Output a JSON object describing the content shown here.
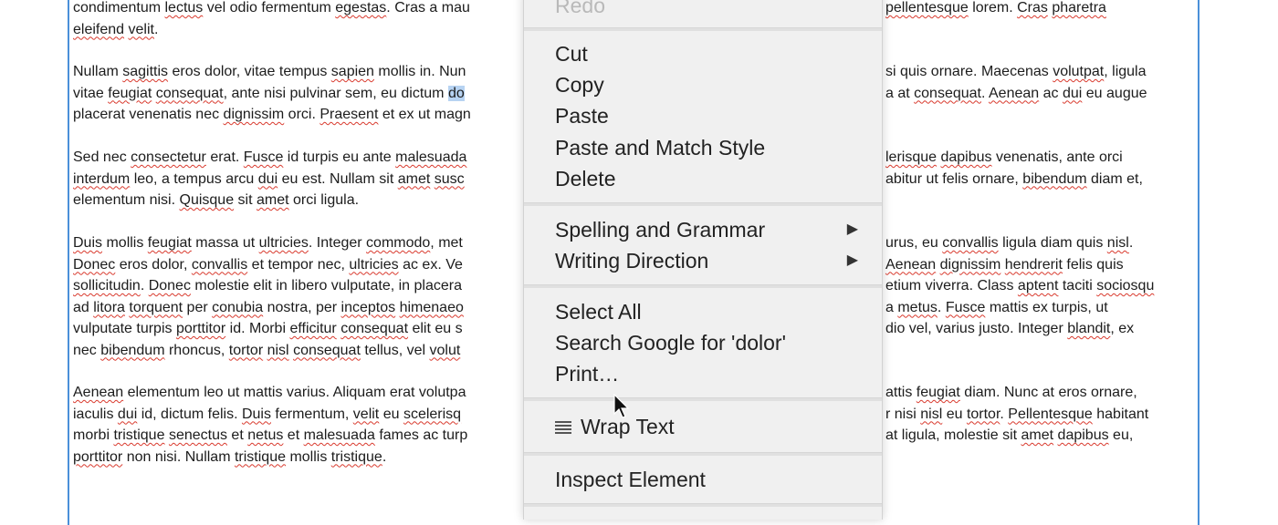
{
  "document": {
    "paragraphs": [
      {
        "lines": [
          [
            {
              "t": "condimentum "
            },
            {
              "t": "lectus",
              "sp": true
            },
            {
              "t": " vel odio fermentum "
            },
            {
              "t": "egestas",
              "sp": true
            },
            {
              "t": ". Cras a mau"
            }
          ],
          [
            {
              "t": "eleifend",
              "sp": true
            },
            {
              "t": " "
            },
            {
              "t": "velit",
              "sp": true
            },
            {
              "t": "."
            }
          ]
        ],
        "right_lines": [
          [
            {
              "t": "pellentesque",
              "sp": true
            },
            {
              "t": " lorem. "
            },
            {
              "t": "Cras",
              "sp": true
            },
            {
              "t": " "
            },
            {
              "t": "pharetra",
              "sp": true
            }
          ]
        ]
      },
      {
        "lines": [
          [
            {
              "t": "Nullam "
            },
            {
              "t": "sagittis",
              "sp": true
            },
            {
              "t": " eros dolor, vitae tempus "
            },
            {
              "t": "sapien",
              "sp": true
            },
            {
              "t": " mollis in. Nun"
            }
          ],
          [
            {
              "t": "vitae "
            },
            {
              "t": "feugiat",
              "sp": true
            },
            {
              "t": " "
            },
            {
              "t": "consequat",
              "sp": true
            },
            {
              "t": ", ante nisi pulvinar sem, eu dictum "
            },
            {
              "t": "do",
              "hl": true
            }
          ],
          [
            {
              "t": "placerat venenatis nec "
            },
            {
              "t": "dignissim",
              "sp": true
            },
            {
              "t": " orci. "
            },
            {
              "t": "Praesent",
              "sp": true
            },
            {
              "t": " et ex ut magn"
            }
          ]
        ],
        "right_lines": [
          [
            {
              "t": "si quis ornare. Maecenas "
            },
            {
              "t": "volutpat",
              "sp": true
            },
            {
              "t": ", ligula"
            }
          ],
          [
            {
              "t": "a at "
            },
            {
              "t": "consequat",
              "sp": true
            },
            {
              "t": ". "
            },
            {
              "t": "Aenean",
              "sp": true
            },
            {
              "t": " ac "
            },
            {
              "t": "dui",
              "sp": true
            },
            {
              "t": " eu augue"
            }
          ]
        ]
      },
      {
        "lines": [
          [
            {
              "t": "Sed nec "
            },
            {
              "t": "consectetur",
              "sp": true
            },
            {
              "t": " erat. "
            },
            {
              "t": "Fusce",
              "sp": true
            },
            {
              "t": " id turpis eu ante "
            },
            {
              "t": "malesuada",
              "sp": true
            }
          ],
          [
            {
              "t": "interdum",
              "sp": true
            },
            {
              "t": " leo, a tempus arcu "
            },
            {
              "t": "dui",
              "sp": true
            },
            {
              "t": " eu est. Nullam sit "
            },
            {
              "t": "amet",
              "sp": true
            },
            {
              "t": " "
            },
            {
              "t": "susc",
              "sp": true
            }
          ],
          [
            {
              "t": "elementum nisi. "
            },
            {
              "t": "Quisque",
              "sp": true
            },
            {
              "t": " sit "
            },
            {
              "t": "amet",
              "sp": true
            },
            {
              "t": " orci ligula."
            }
          ]
        ],
        "right_lines": [
          [
            {
              "t": "lerisque",
              "sp": true
            },
            {
              "t": " "
            },
            {
              "t": "dapibus",
              "sp": true
            },
            {
              "t": " venenatis, ante orci"
            }
          ],
          [
            {
              "t": "abitur ut felis ornare, "
            },
            {
              "t": "bibendum",
              "sp": true
            },
            {
              "t": " diam et,"
            }
          ]
        ]
      },
      {
        "lines": [
          [
            {
              "t": "Duis",
              "sp": true
            },
            {
              "t": " mollis "
            },
            {
              "t": "feugiat",
              "sp": true
            },
            {
              "t": " massa ut "
            },
            {
              "t": "ultricies",
              "sp": true
            },
            {
              "t": ". Integer "
            },
            {
              "t": "commodo",
              "sp": true
            },
            {
              "t": ", met"
            }
          ],
          [
            {
              "t": "Donec",
              "sp": true
            },
            {
              "t": " eros dolor, "
            },
            {
              "t": "convallis",
              "sp": true
            },
            {
              "t": " et tempor nec, "
            },
            {
              "t": "ultricies",
              "sp": true
            },
            {
              "t": " ac ex. Ve"
            }
          ],
          [
            {
              "t": "sollicitudin",
              "sp": true
            },
            {
              "t": ". "
            },
            {
              "t": "Donec",
              "sp": true
            },
            {
              "t": " molestie elit in libero vulputate, in placera"
            }
          ],
          [
            {
              "t": "ad "
            },
            {
              "t": "litora",
              "sp": true
            },
            {
              "t": " "
            },
            {
              "t": "torquent",
              "sp": true
            },
            {
              "t": " per "
            },
            {
              "t": "conubia",
              "sp": true
            },
            {
              "t": " nostra, per "
            },
            {
              "t": "inceptos",
              "sp": true
            },
            {
              "t": " "
            },
            {
              "t": "himenaeo",
              "sp": true
            }
          ],
          [
            {
              "t": "vulputate turpis "
            },
            {
              "t": "porttitor",
              "sp": true
            },
            {
              "t": " id. Morbi "
            },
            {
              "t": "efficitur",
              "sp": true
            },
            {
              "t": " "
            },
            {
              "t": "consequat",
              "sp": true
            },
            {
              "t": " elit eu s"
            }
          ],
          [
            {
              "t": "nec "
            },
            {
              "t": "bibendum",
              "sp": true
            },
            {
              "t": " rhoncus, "
            },
            {
              "t": "tortor",
              "sp": true
            },
            {
              "t": " "
            },
            {
              "t": "nisl",
              "sp": true
            },
            {
              "t": " "
            },
            {
              "t": "consequat",
              "sp": true
            },
            {
              "t": " tellus, vel "
            },
            {
              "t": "volut",
              "sp": true
            }
          ]
        ],
        "right_lines": [
          [
            {
              "t": "urus, eu "
            },
            {
              "t": "convallis",
              "sp": true
            },
            {
              "t": " ligula diam quis "
            },
            {
              "t": "nisl",
              "sp": true
            },
            {
              "t": "."
            }
          ],
          [
            {
              "t": "Aenean",
              "sp": true
            },
            {
              "t": " "
            },
            {
              "t": "dignissim",
              "sp": true
            },
            {
              "t": " "
            },
            {
              "t": "hendrerit",
              "sp": true
            },
            {
              "t": " felis quis"
            }
          ],
          [
            {
              "t": "etium viverra. Class "
            },
            {
              "t": "aptent",
              "sp": true
            },
            {
              "t": " taciti "
            },
            {
              "t": "sociosqu",
              "sp": true
            }
          ],
          [
            {
              "t": "a "
            },
            {
              "t": "metus",
              "sp": true
            },
            {
              "t": ". "
            },
            {
              "t": "Fusce",
              "sp": true
            },
            {
              "t": " mattis ex turpis, ut"
            }
          ],
          [
            {
              "t": "dio vel, varius justo. Integer "
            },
            {
              "t": "blandit",
              "sp": true
            },
            {
              "t": ", ex"
            }
          ]
        ]
      },
      {
        "lines": [
          [
            {
              "t": "Aenean",
              "sp": true
            },
            {
              "t": " elementum leo ut mattis varius. Aliquam erat volutpa"
            }
          ],
          [
            {
              "t": "iaculis "
            },
            {
              "t": "dui",
              "sp": true
            },
            {
              "t": " id, dictum felis. "
            },
            {
              "t": "Duis",
              "sp": true
            },
            {
              "t": " fermentum, "
            },
            {
              "t": "velit",
              "sp": true
            },
            {
              "t": " eu "
            },
            {
              "t": "scelerisq",
              "sp": true
            }
          ],
          [
            {
              "t": "morbi "
            },
            {
              "t": "tristique",
              "sp": true
            },
            {
              "t": " "
            },
            {
              "t": "senectus",
              "sp": true
            },
            {
              "t": " et "
            },
            {
              "t": "netus",
              "sp": true
            },
            {
              "t": " et "
            },
            {
              "t": "malesuada",
              "sp": true
            },
            {
              "t": " fames ac turp"
            }
          ],
          [
            {
              "t": "porttitor",
              "sp": true
            },
            {
              "t": " non nisi. Nullam "
            },
            {
              "t": "tristique",
              "sp": true
            },
            {
              "t": " mollis "
            },
            {
              "t": "tristique",
              "sp": true
            },
            {
              "t": "."
            }
          ]
        ],
        "right_lines": [
          [
            {
              "t": "attis "
            },
            {
              "t": "feugiat",
              "sp": true
            },
            {
              "t": " diam. Nunc at eros ornare,"
            }
          ],
          [
            {
              "t": "r nisi "
            },
            {
              "t": "nisl",
              "sp": true
            },
            {
              "t": " eu "
            },
            {
              "t": "tortor",
              "sp": true
            },
            {
              "t": ". "
            },
            {
              "t": "Pellentesque",
              "sp": true
            },
            {
              "t": " habitant"
            }
          ],
          [
            {
              "t": "at ligula, molestie sit "
            },
            {
              "t": "amet",
              "sp": true
            },
            {
              "t": " "
            },
            {
              "t": "dapibus",
              "sp": true
            },
            {
              "t": " eu,"
            }
          ]
        ]
      }
    ]
  },
  "context_menu": {
    "redo_label": "Redo",
    "cut_label": "Cut",
    "copy_label": "Copy",
    "paste_label": "Paste",
    "paste_match_label": "Paste and Match Style",
    "delete_label": "Delete",
    "spelling_label": "Spelling and Grammar",
    "writing_direction_label": "Writing Direction",
    "select_all_label": "Select All",
    "search_google_label": "Search Google for 'dolor'",
    "print_label": "Print…",
    "wrap_text_label": "Wrap Text",
    "inspect_label": "Inspect Element",
    "submenu_arrow": "▶"
  },
  "icons": {
    "wrap_text": "wrap-text-icon",
    "submenu": "chevron-right-icon",
    "cursor": "mouse-pointer-icon"
  }
}
